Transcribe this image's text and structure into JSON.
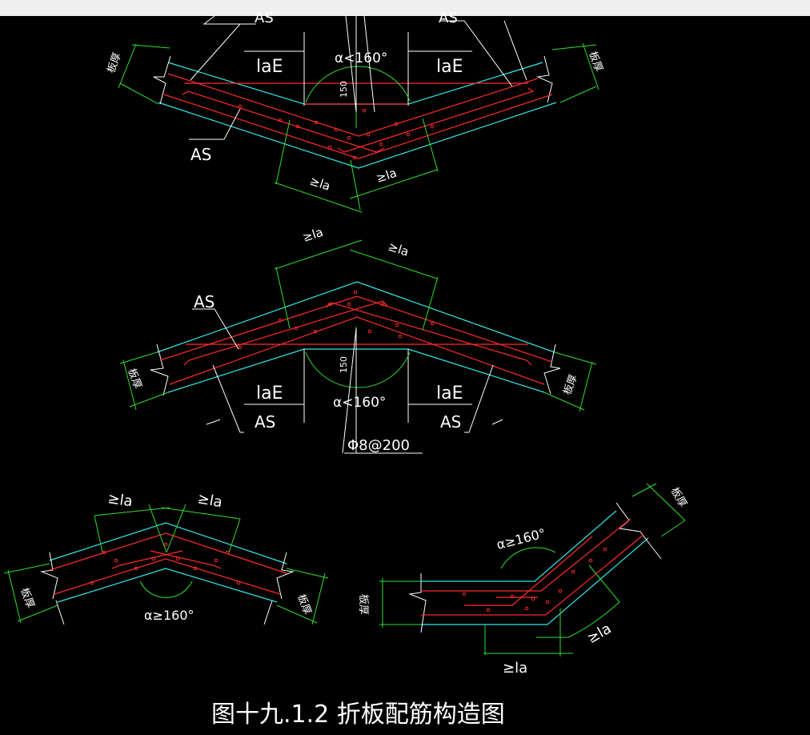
{
  "labels": {
    "as": "AS",
    "lae": "laE",
    "la": "≥la",
    "angle_lt": "α<160°",
    "angle_ge": "α≥160°",
    "dim_150": "150",
    "rebar": "Φ8@200",
    "thickness": "板厚"
  },
  "caption": "图十九.1.2  折板配筋构造图",
  "colors": {
    "background": "#000000",
    "concrete_outline": "#33e6e6",
    "rebar": "#ff2a2a",
    "dimension": "#2ee02e",
    "annotation": "#ffffff"
  }
}
